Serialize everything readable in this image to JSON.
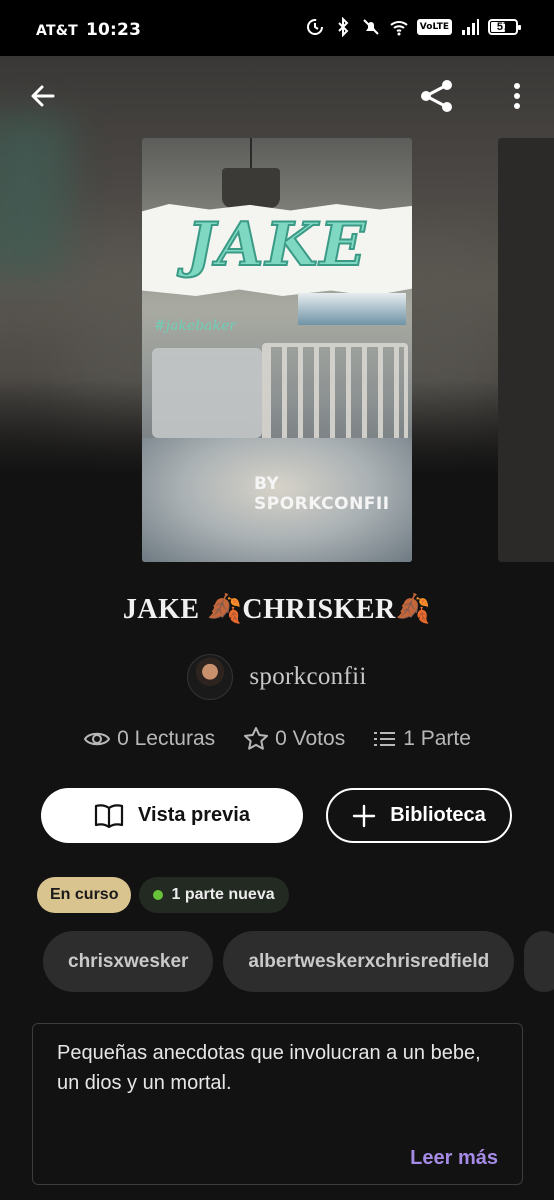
{
  "status_bar": {
    "carrier": "AT&T",
    "time": "10:23",
    "network_badge": "VoLTE",
    "battery": "57",
    "battery_fraction": 0.57,
    "icons": [
      "data-saver-icon",
      "bluetooth-icon",
      "mute-icon",
      "wifi-icon",
      "volte-icon",
      "signal-icon",
      "battery-icon"
    ]
  },
  "topbar": {
    "icons": [
      "back-arrow-icon",
      "share-icon",
      "more-vert-icon"
    ]
  },
  "cover": {
    "title": "JAKE",
    "subtext": "#jakebaker",
    "byline": "BY SPORKCONFII"
  },
  "story": {
    "title": "JAKE 🍂CHRISKER🍂",
    "author": "sporkconfii"
  },
  "stats": {
    "reads": "0 Lecturas",
    "votes": "0 Votos",
    "parts": "1 Parte"
  },
  "actions": {
    "preview_label": "Vista previa",
    "library_label": "Biblioteca"
  },
  "badges": {
    "status": "En curso",
    "new_parts": "1 parte nueva"
  },
  "tags": [
    "chrisxwesker",
    "albertweskerxchrisredfield"
  ],
  "description": {
    "text": "Pequeñas anecdotas que involucran a un bebe, un dios y un mortal.",
    "read_more": "Leer más"
  },
  "colors": {
    "background": "#121212",
    "status_chip": "#d9c38f",
    "accent_link": "#a58be6",
    "new_dot": "#67c23a"
  }
}
